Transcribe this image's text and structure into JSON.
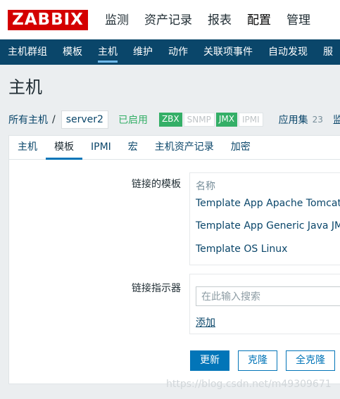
{
  "logo": "ZABBIX",
  "top_menu": [
    "监测",
    "资产记录",
    "报表",
    "配置",
    "管理"
  ],
  "sub_menu": [
    "主机群组",
    "模板",
    "主机",
    "维护",
    "动作",
    "关联项事件",
    "自动发现",
    "服"
  ],
  "page_title": "主机",
  "breadcrumb": {
    "all_hosts": "所有主机",
    "separator": "/",
    "current": "server2",
    "status": "已启用",
    "badges": [
      "ZBX",
      "SNMP",
      "JMX",
      "IPMI"
    ],
    "applications": "应用集",
    "applications_count": "23",
    "monitoring": "监"
  },
  "tabs": [
    "主机",
    "模板",
    "IPMI",
    "宏",
    "主机资产记录",
    "加密"
  ],
  "linked_templates": {
    "label": "链接的模板",
    "column_header": "名称",
    "items": [
      "Template App Apache Tomcat JM",
      "Template App Generic Java JMX",
      "Template OS Linux"
    ]
  },
  "link_new": {
    "label": "链接指示器",
    "placeholder": "在此输入搜索",
    "add_link": "添加"
  },
  "buttons": {
    "update": "更新",
    "clone": "克隆",
    "full_clone": "全克隆"
  },
  "watermark": "https://blog.csdn.net/m49309671",
  "colors": {
    "brand_red": "#d40000",
    "nav_blue": "#0a466a",
    "accent_blue": "#0275b8",
    "enabled_green": "#34af67"
  }
}
